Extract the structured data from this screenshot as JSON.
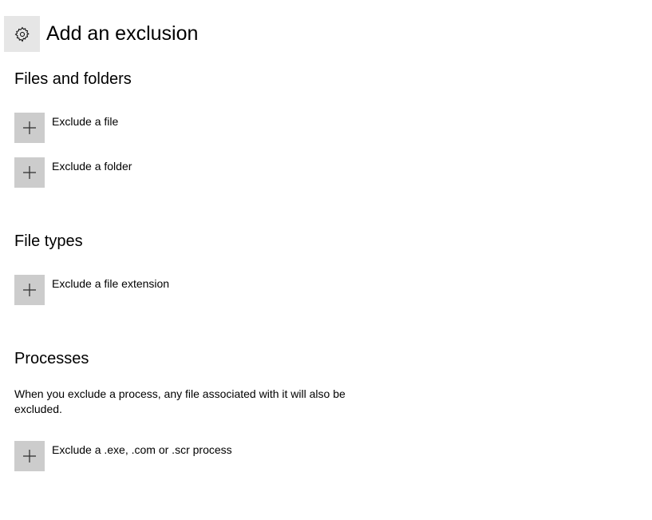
{
  "header": {
    "title": "Add an exclusion",
    "icon": "gear-icon"
  },
  "sections": {
    "files_and_folders": {
      "title": "Files and folders",
      "items": [
        {
          "label": "Exclude a file",
          "icon": "plus-icon"
        },
        {
          "label": "Exclude a folder",
          "icon": "plus-icon"
        }
      ]
    },
    "file_types": {
      "title": "File types",
      "items": [
        {
          "label": "Exclude a file extension",
          "icon": "plus-icon"
        }
      ]
    },
    "processes": {
      "title": "Processes",
      "description": "When you exclude a process, any file associated with it will also be excluded.",
      "items": [
        {
          "label": "Exclude a .exe, .com or .scr process",
          "icon": "plus-icon"
        }
      ]
    }
  },
  "colors": {
    "background": "#ffffff",
    "gear_tile": "#e6e6e6",
    "plus_tile": "#cccccc",
    "text": "#000000"
  }
}
